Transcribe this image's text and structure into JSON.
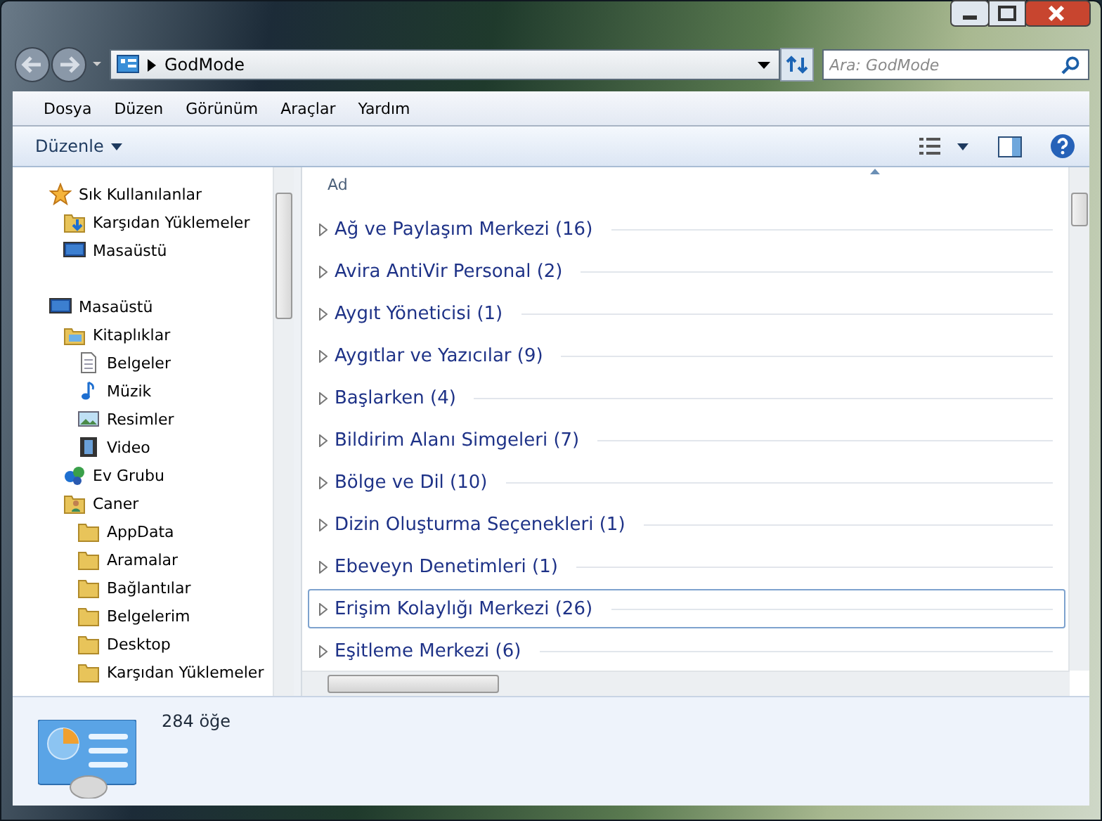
{
  "window": {
    "address": "GodMode",
    "search": {
      "placeholder": "Ara: GodMode"
    }
  },
  "menu": [
    "Dosya",
    "Düzen",
    "Görünüm",
    "Araçlar",
    "Yardım"
  ],
  "toolbar": {
    "organize": "Düzenle"
  },
  "sidebar": {
    "items": [
      {
        "label": "Sık Kullanılanlar",
        "kind": "star",
        "children": [
          {
            "label": "Karşıdan Yüklemeler",
            "kind": "download"
          },
          {
            "label": "Masaüstü",
            "kind": "desktop"
          }
        ]
      },
      {
        "label": "Masaüstü",
        "kind": "desktop",
        "children": [
          {
            "label": "Kitaplıklar",
            "kind": "library",
            "children": [
              {
                "label": "Belgeler",
                "kind": "document"
              },
              {
                "label": "Müzik",
                "kind": "music"
              },
              {
                "label": "Resimler",
                "kind": "picture"
              },
              {
                "label": "Video",
                "kind": "video"
              }
            ]
          },
          {
            "label": "Ev Grubu",
            "kind": "homegroup"
          },
          {
            "label": "Caner",
            "kind": "user",
            "children": [
              {
                "label": "AppData",
                "kind": "folder"
              },
              {
                "label": "Aramalar",
                "kind": "folder"
              },
              {
                "label": "Bağlantılar",
                "kind": "folder"
              },
              {
                "label": "Belgelerim",
                "kind": "folder"
              },
              {
                "label": "Desktop",
                "kind": "folder"
              },
              {
                "label": "Karşıdan Yüklemeler",
                "kind": "folder"
              }
            ]
          }
        ]
      }
    ]
  },
  "list": {
    "column": "Ad",
    "groups": [
      {
        "label": "Ağ ve Paylaşım Merkezi (16)",
        "focused": false
      },
      {
        "label": "Avira AntiVir Personal (2)",
        "focused": false
      },
      {
        "label": "Aygıt Yöneticisi (1)",
        "focused": false
      },
      {
        "label": "Aygıtlar ve Yazıcılar (9)",
        "focused": false
      },
      {
        "label": "Başlarken (4)",
        "focused": false
      },
      {
        "label": "Bildirim Alanı Simgeleri (7)",
        "focused": false
      },
      {
        "label": "Bölge ve Dil (10)",
        "focused": false
      },
      {
        "label": "Dizin Oluşturma Seçenekleri (1)",
        "focused": false
      },
      {
        "label": "Ebeveyn Denetimleri (1)",
        "focused": false
      },
      {
        "label": "Erişim Kolaylığı Merkezi (26)",
        "focused": true
      },
      {
        "label": "Eşitleme Merkezi (6)",
        "focused": false
      }
    ]
  },
  "details": {
    "count": "284 öğe"
  }
}
